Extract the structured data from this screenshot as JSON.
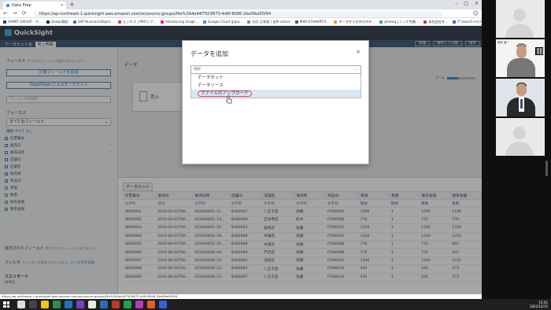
{
  "browser": {
    "tab_title": "Data Prep",
    "url": "https://ap-northeast-1.quicksight.aws.amazon.com/sn/source-groups/f4e%3A4e44f75f-8673-4d9f-8006-2be0fbe55f94",
    "bookmarks": [
      {
        "label": "AVANT GROUP – ホ...",
        "color": "#1a3a6b"
      },
      {
        "label": "DeepL翻訳",
        "color": "#0f2b46"
      },
      {
        "label": "SAP BusinessObject...",
        "color": "#2b78c2"
      },
      {
        "label": "ビジネス | PROジブ...",
        "color": "#d44"
      },
      {
        "label": "Introducing Insigh...",
        "color": "#f09"
      },
      {
        "label": "Google Cloud (Japa...",
        "color": "#4285f4"
      },
      {
        "label": "対応 日本語 | 白Bi online",
        "color": "#888"
      },
      {
        "label": "MXR-S7HAKRT-X...",
        "color": "#555"
      },
      {
        "label": "データからの学びのデ...",
        "color": "#e91"
      },
      {
        "label": "phreeq | ニッケ究業...",
        "color": "#3a8"
      },
      {
        "label": "本社会社を...",
        "color": "#c33"
      },
      {
        "label": "IT Search+ログ...",
        "color": "#36c"
      }
    ]
  },
  "app": {
    "logo": "QuickSight",
    "dataset_label": "データセット名",
    "dataset_name": "売上明細",
    "header_buttons": [
      "管理",
      "保存して公開",
      "保存"
    ]
  },
  "left_panel": {
    "fields_title": "フィールド",
    "fields_sub": "すべてのフィールドが選択されています",
    "add_calc_button": "計算フィールドを追加",
    "sagemaker_button": "SageMaker によるオーグメント",
    "search_placeholder": "フィールドの検索",
    "focus_title": "フォーカス",
    "focus_value": "すべてのフィールド",
    "select_label": "選択",
    "select_all": "すべて",
    "select_none": "なし",
    "fields": [
      {
        "name": "伝票番号",
        "type": "text"
      },
      {
        "name": "販売日",
        "type": "date"
      },
      {
        "name": "販売日時",
        "type": "text"
      },
      {
        "name": "店舗ID",
        "type": "text"
      },
      {
        "name": "店舗名",
        "type": "text"
      },
      {
        "name": "販売者",
        "type": "text"
      },
      {
        "name": "商品ID",
        "type": "text"
      },
      {
        "name": "単価",
        "type": "number"
      },
      {
        "name": "数量",
        "type": "number"
      },
      {
        "name": "販売金額",
        "type": "number"
      },
      {
        "name": "税率金額",
        "type": "number"
      }
    ],
    "excluded_title": "除外されたフィールド",
    "excluded_sub": "除外されたフィールドはありません",
    "filter_title": "フィルタ",
    "filter_sub": "フィルターは適用されていません",
    "filter_add": "フィルタを追加",
    "query_title": "クエリモード",
    "query_value": "SPICE"
  },
  "canvas": {
    "title": "データ",
    "node_label": "売上",
    "zoom_label": "ズーム",
    "zoom_fraction": 0.4
  },
  "dialog": {
    "title": "データを追加",
    "select_placeholder": "選択",
    "options": [
      "データセット",
      "データソース",
      "ファイルのアップロード"
    ],
    "highlighted_index": 2
  },
  "table": {
    "tab_label": "データセット",
    "columns": [
      "伝票番号",
      "販売日",
      "販売日時",
      "店舗ID",
      "店舗名",
      "販売者",
      "商品ID",
      "単価",
      "数量",
      "販売金額",
      "税率金額"
    ],
    "types": [
      "文字列",
      "日付",
      "文字列",
      "文字列",
      "文字列",
      "文字列",
      "文字列",
      "整数",
      "整数",
      "整数",
      "整数"
    ],
    "rows": [
      [
        "OR00001",
        "2019-04-01T00...",
        "2019/04/01 11...",
        "SH00007",
        "八王子店",
        "高橋",
        "IT000005",
        "1595",
        "1",
        "1595",
        "1196"
      ],
      [
        "OR00002",
        "2019-04-01T00...",
        "2019/04/01 13...",
        "SH00009",
        "吉祥寺店",
        "鈴木",
        "IT000006",
        "770",
        "1",
        "770",
        "770"
      ],
      [
        "OR00003",
        "2019-04-01T00...",
        "2019/04/01 16...",
        "SH00003",
        "森岡店",
        "佐藤",
        "IT000011",
        "1320",
        "1",
        "1320",
        "1320"
      ],
      [
        "OR00004",
        "2019-04-01T00...",
        "2019/04/01 18...",
        "SH00008",
        "木場店",
        "高橋",
        "IT000011",
        "1320",
        "1",
        "1320",
        "1254"
      ],
      [
        "OR00005",
        "2019-04-01T00...",
        "2019/04/01 20...",
        "SH00008",
        "木場店",
        "高橋",
        "IT000006",
        "770",
        "1",
        "770",
        "665"
      ],
      [
        "OR00006",
        "2019-04-02T00...",
        "2019/04/02 09...",
        "SH00009",
        "芦沢店",
        "高橋",
        "IT000006",
        "770",
        "1",
        "770",
        "647"
      ],
      [
        "OR00007",
        "2019-04-02T00...",
        "2019/04/02 10...",
        "SH00001",
        "池袋店",
        "高橋",
        "IT000001",
        "1540",
        "1",
        "1540",
        "1232"
      ],
      [
        "OR00008",
        "2019-04-02T00...",
        "2019/04/02 12...",
        "SH00003",
        "八王子店",
        "佐藤",
        "IT000010",
        "545",
        "1",
        "545",
        "573"
      ],
      [
        "OR00009",
        "2019-04-02T00...",
        "2019/04/02 15...",
        "SH00007",
        "八王子店",
        "佐藤",
        "IT000010",
        "545",
        "1",
        "545",
        "573"
      ]
    ]
  },
  "status_bar": "https://ap-northeast-1.quicksight.aws.amazon.com/sn/source-groups/f4e%3A4e44f75f-8673-4d9f-8006-2be0fbe55f94",
  "taskbar": {
    "time": "15:01",
    "date": "2021/12/15",
    "app_colors": [
      "#ddd",
      "#444",
      "#f0c419",
      "#2e8b57",
      "#1e73be",
      "#7a3fc4",
      "#e8e8e8",
      "#2a6ebb",
      "#c0392b",
      "#1fa34a",
      "#b13dbe",
      "#e85a2e",
      "#355fd6"
    ]
  },
  "video": {
    "participant_name": "岡本 直一"
  }
}
